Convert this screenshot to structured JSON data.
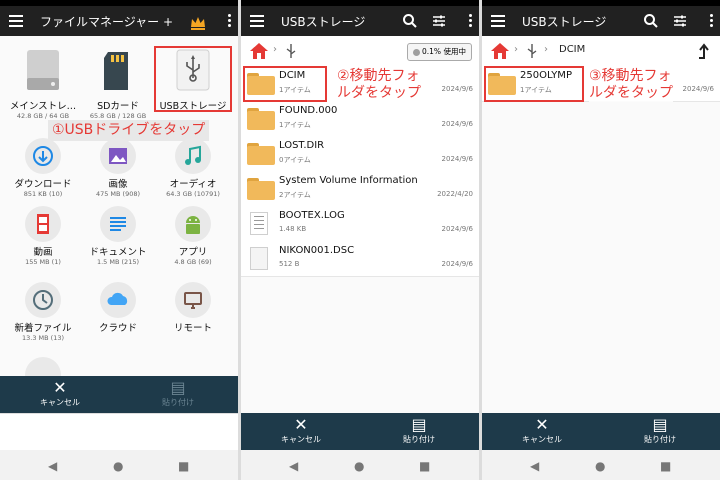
{
  "panel1": {
    "title": "ファイルマネージャー +",
    "items": [
      {
        "label": "メインストレ…",
        "sub": "42.8 GB / 64 GB",
        "icon": "drive-icon"
      },
      {
        "label": "SDカード",
        "sub": "65.8 GB / 128 GB",
        "icon": "sd-card-icon"
      },
      {
        "label": "USBストレージ",
        "sub": "",
        "icon": "usb-icon"
      },
      {
        "label": "ダウンロード",
        "sub": "851 KB (10)",
        "icon": "download-icon"
      },
      {
        "label": "画像",
        "sub": "475 MB (908)",
        "icon": "image-icon"
      },
      {
        "label": "オーディオ",
        "sub": "64.3 GB (10791)",
        "icon": "music-icon"
      },
      {
        "label": "動画",
        "sub": "155 MB (1)",
        "icon": "film-icon"
      },
      {
        "label": "ドキュメント",
        "sub": "1.5 MB (215)",
        "icon": "document-icon"
      },
      {
        "label": "アプリ",
        "sub": "4.8 GB (69)",
        "icon": "android-icon"
      },
      {
        "label": "新着ファイル",
        "sub": "13.3 MB (13)",
        "icon": "clock-icon"
      },
      {
        "label": "クラウド",
        "sub": "",
        "icon": "cloud-icon"
      },
      {
        "label": "リモート",
        "sub": "",
        "icon": "monitor-icon"
      }
    ],
    "callout": "①USBドライブをタップ",
    "cancel": "キャンセル",
    "paste": "貼り付け"
  },
  "panel2": {
    "title": "USBストレージ",
    "usage": "0.1% 使用中",
    "callout_line1": "②移動先フォ",
    "callout_line2": "ルダをタップ",
    "rows": [
      {
        "name": "DCIM",
        "sub": "1アイテム",
        "date": "2024/9/6",
        "type": "folder"
      },
      {
        "name": "FOUND.000",
        "sub": "1アイテム",
        "date": "2024/9/6",
        "type": "folder"
      },
      {
        "name": "LOST.DIR",
        "sub": "0アイテム",
        "date": "2024/9/6",
        "type": "folder"
      },
      {
        "name": "System Volume Information",
        "sub": "2アイテム",
        "date": "2022/4/20",
        "type": "folder"
      },
      {
        "name": "BOOTEX.LOG",
        "sub": "1.48 KB",
        "date": "2024/9/6",
        "type": "file"
      },
      {
        "name": "NIKON001.DSC",
        "sub": "512 B",
        "date": "2024/9/6",
        "type": "file"
      }
    ],
    "cancel": "キャンセル",
    "paste": "貼り付け"
  },
  "panel3": {
    "title": "USBストレージ",
    "crumb": "DCIM",
    "callout_line1": "③移動先フォ",
    "callout_line2": "ルダをタップ",
    "rows": [
      {
        "name": "250OLYMP",
        "sub": "1アイテム",
        "date": "2024/9/6",
        "type": "folder"
      }
    ],
    "cancel": "キャンセル",
    "paste": "貼り付け"
  },
  "colors": {
    "appbar": "#212121",
    "bottombar": "#1e3a4a",
    "highlight": "#e53935",
    "folder": "#f1b95b",
    "crown": "#f5a623"
  }
}
